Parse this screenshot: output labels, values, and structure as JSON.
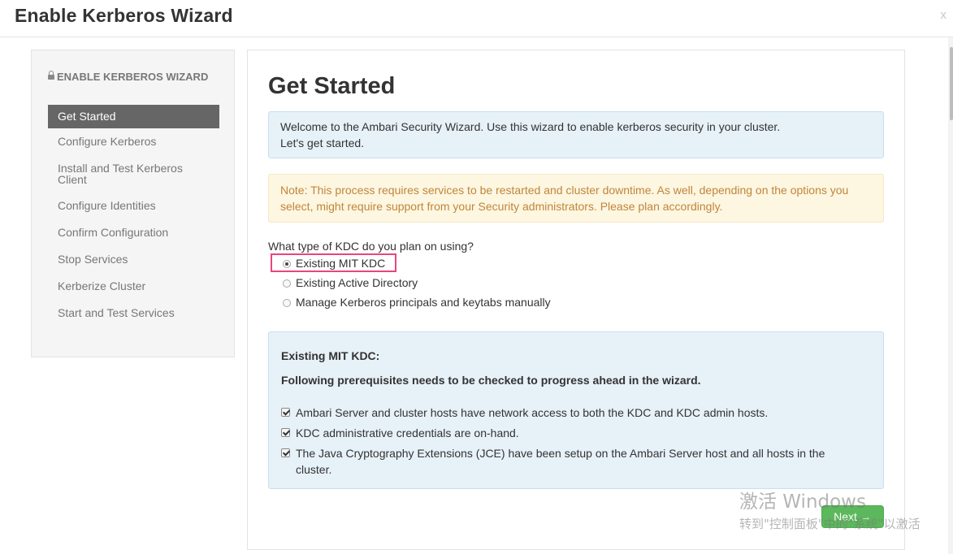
{
  "modal": {
    "title": "Enable Kerberos Wizard",
    "close_label": "x"
  },
  "sidebar": {
    "header": "ENABLE KERBEROS WIZARD",
    "items": [
      {
        "label": "Get Started",
        "active": true
      },
      {
        "label": "Configure Kerberos",
        "active": false
      },
      {
        "label": "Install and Test Kerberos Client",
        "active": false
      },
      {
        "label": "Configure Identities",
        "active": false
      },
      {
        "label": "Confirm Configuration",
        "active": false
      },
      {
        "label": "Stop Services",
        "active": false
      },
      {
        "label": "Kerberize Cluster",
        "active": false
      },
      {
        "label": "Start and Test Services",
        "active": false
      }
    ]
  },
  "main": {
    "title": "Get Started",
    "info_line1": "Welcome to the Ambari Security Wizard. Use this wizard to enable kerberos security in your cluster.",
    "info_line2": "Let's get started.",
    "warning": "Note: This process requires services to be restarted and cluster downtime. As well, depending on the options you select, might require support from your Security administrators. Please plan accordingly.",
    "kdc_question": "What type of KDC do you plan on using?",
    "kdc_options": [
      {
        "label": "Existing MIT KDC",
        "selected": true
      },
      {
        "label": "Existing Active Directory",
        "selected": false
      },
      {
        "label": "Manage Kerberos principals and keytabs manually",
        "selected": false
      }
    ],
    "prereq": {
      "title": "Existing MIT KDC:",
      "subtitle": "Following prerequisites needs to be checked to progress ahead in the wizard.",
      "items": [
        {
          "label": "Ambari Server and cluster hosts have network access to both the KDC and KDC admin hosts.",
          "checked": true
        },
        {
          "label": "KDC administrative credentials are on-hand.",
          "checked": true
        },
        {
          "label": "The Java Cryptography Extensions (JCE) have been setup on the Ambari Server host and all hosts in the cluster.",
          "checked": true
        }
      ]
    },
    "next_label": "Next →"
  },
  "watermark": {
    "line1": "激活 Windows",
    "line2": "转到\"控制面板\"中的\"系统\"以激活"
  },
  "colors": {
    "active_nav_bg": "#666666",
    "info_bg": "#e7f1f8",
    "warning_bg": "#fdf6e1",
    "warning_text": "#c0863a",
    "next_button_bg": "#5cb85c",
    "highlight_border": "#e8467c"
  }
}
